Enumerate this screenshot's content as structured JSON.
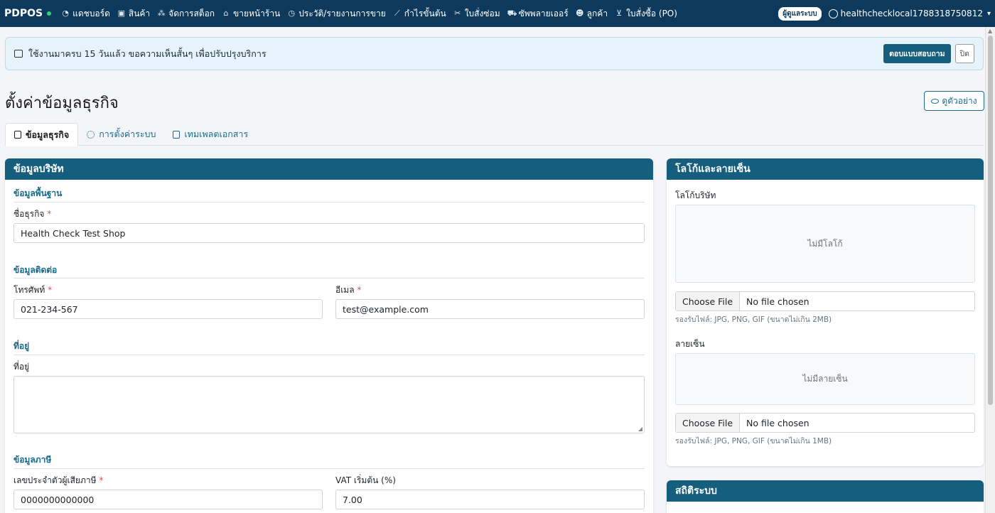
{
  "navbar": {
    "brand": "PDPOS",
    "items": [
      {
        "label": "แดชบอร์ด",
        "icon": "dashboard-icon",
        "glyph": "◔"
      },
      {
        "label": "สินค้า",
        "icon": "box-icon",
        "glyph": "▣"
      },
      {
        "label": "จัดการสต็อก",
        "icon": "cubes-icon",
        "glyph": "⁂"
      },
      {
        "label": "ขายหน้าร้าน",
        "icon": "store-icon",
        "glyph": "⌂"
      },
      {
        "label": "ประวัติ/รายงานการขาย",
        "icon": "clock-icon",
        "glyph": "◷"
      },
      {
        "label": "กำไรขั้นต้น",
        "icon": "chart-line-icon",
        "glyph": "⟋"
      },
      {
        "label": "ใบสั่งซ่อม",
        "icon": "tools-icon",
        "glyph": "✂"
      },
      {
        "label": "ซัพพลายเออร์",
        "icon": "truck-icon",
        "glyph": "⛟"
      },
      {
        "label": "ลูกค้า",
        "icon": "users-icon",
        "glyph": "☻"
      },
      {
        "label": "ใบสั่งซื้อ (PO)",
        "icon": "cart-icon",
        "glyph": "⊻"
      }
    ],
    "role_badge": "ผู้ดูแลระบบ",
    "username": "healthchecklocal1788318750812"
  },
  "alert": {
    "text": "ใช้งานมาครบ 15 วันแล้ว ขอความเห็นสั้นๆ เพื่อปรับปรุงบริการ",
    "survey_button": "ตอบแบบสอบถาม",
    "close_button": "ปิด"
  },
  "page": {
    "title": "ตั้งค่าข้อมูลธุรกิจ",
    "preview_button": "ดูตัวอย่าง"
  },
  "tabs": [
    {
      "label": "ข้อมูลธุรกิจ",
      "active": true
    },
    {
      "label": "การตั้งค่าระบบ",
      "active": false
    },
    {
      "label": "เทมเพลตเอกสาร",
      "active": false
    }
  ],
  "company_card": {
    "header": "ข้อมูลบริษัท",
    "basic_section": "ข้อมูลพื้นฐาน",
    "business_name_label": "ชื่อธุรกิจ",
    "business_name_value": "Health Check Test Shop",
    "contact_section": "ข้อมูลติดต่อ",
    "phone_label": "โทรศัพท์",
    "phone_value": "021-234-567",
    "email_label": "อีเมล",
    "email_value": "test@example.com",
    "address_section": "ที่อยู่",
    "address_label": "ที่อยู่",
    "address_value": "",
    "tax_section": "ข้อมูลภาษี",
    "tax_id_label": "เลขประจำตัวผู้เสียภาษี",
    "tax_id_value": "0000000000000",
    "vat_label": "VAT เริ่มต้น (%)",
    "vat_value": "7.00"
  },
  "logo_card": {
    "header": "โลโก้และลายเซ็น",
    "logo_label": "โลโก้บริษัท",
    "logo_empty": "ไม่มีโลโก้",
    "choose_file": "Choose File",
    "no_file": "No file chosen",
    "logo_hint": "รองรับไฟล์: JPG, PNG, GIF (ขนาดไม่เกิน 2MB)",
    "signature_label": "ลายเซ็น",
    "signature_empty": "ไม่มีลายเซ็น",
    "signature_hint": "รองรับไฟล์: JPG, PNG, GIF (ขนาดไม่เกิน 1MB)"
  },
  "stats_card": {
    "header": "สถิติระบบ"
  },
  "colors": {
    "navbar": "#0d3a5c",
    "card_header": "#155e7e",
    "accent": "#1a6b8a"
  }
}
